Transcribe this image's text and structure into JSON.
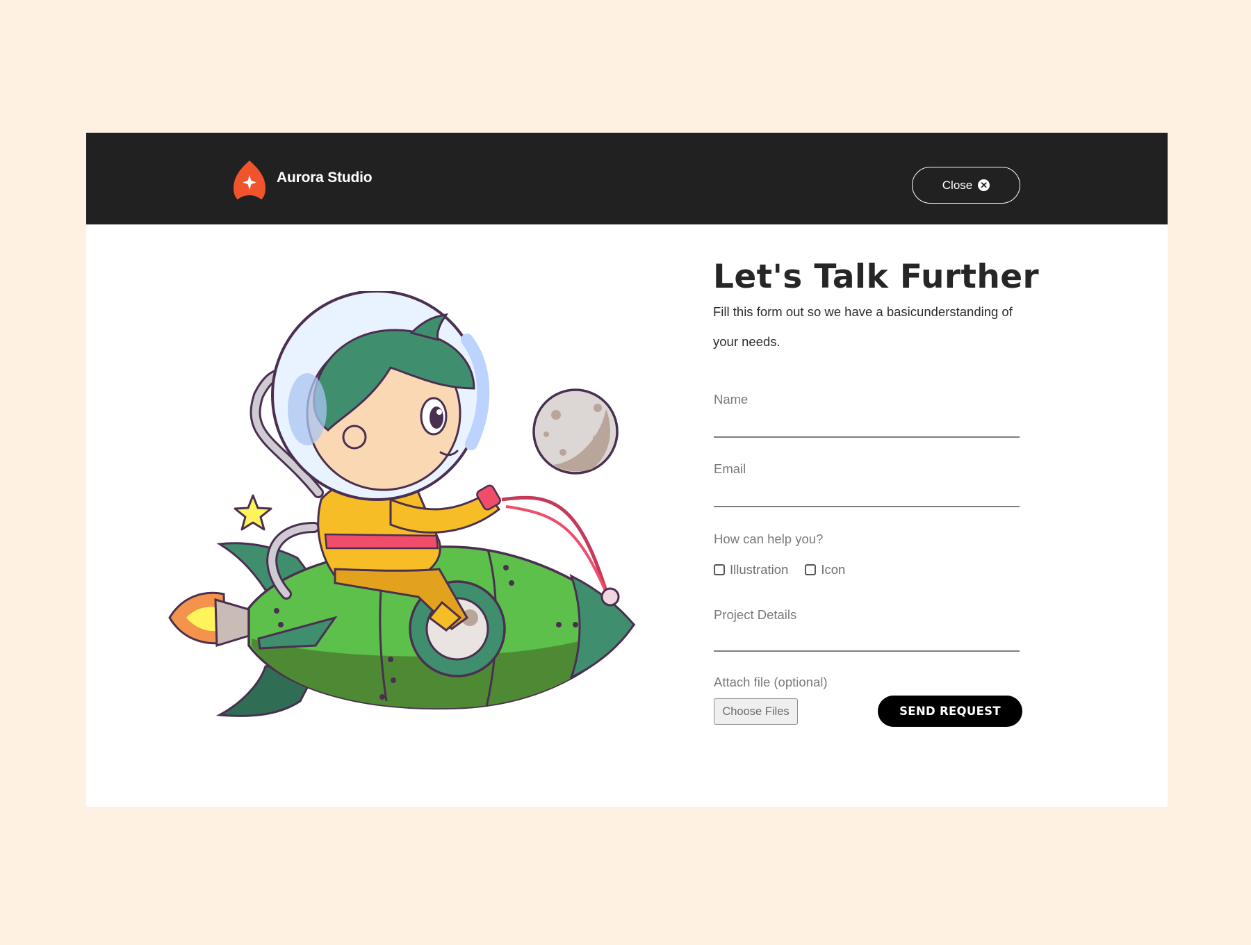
{
  "header": {
    "brand_name": "Aurora Studio",
    "close_label": "Close",
    "close_icon": "close-icon"
  },
  "form": {
    "heading": "Let's Talk Further",
    "intro": "Fill this form out so we have a basicunderstanding of your needs.",
    "name_label": "Name",
    "email_label": "Email",
    "help_label": "How can help you?",
    "options": [
      "Illustration",
      "Icon"
    ],
    "details_label": "Project Details",
    "attach_label": "Attach file (optional)",
    "choose_files_label": "Choose Files",
    "submit_label": "SEND REQUEST"
  },
  "colors": {
    "page_background": "#fff1e1",
    "header_background": "#212121",
    "brand_accent": "#f0542d",
    "submit_background": "#000000"
  }
}
